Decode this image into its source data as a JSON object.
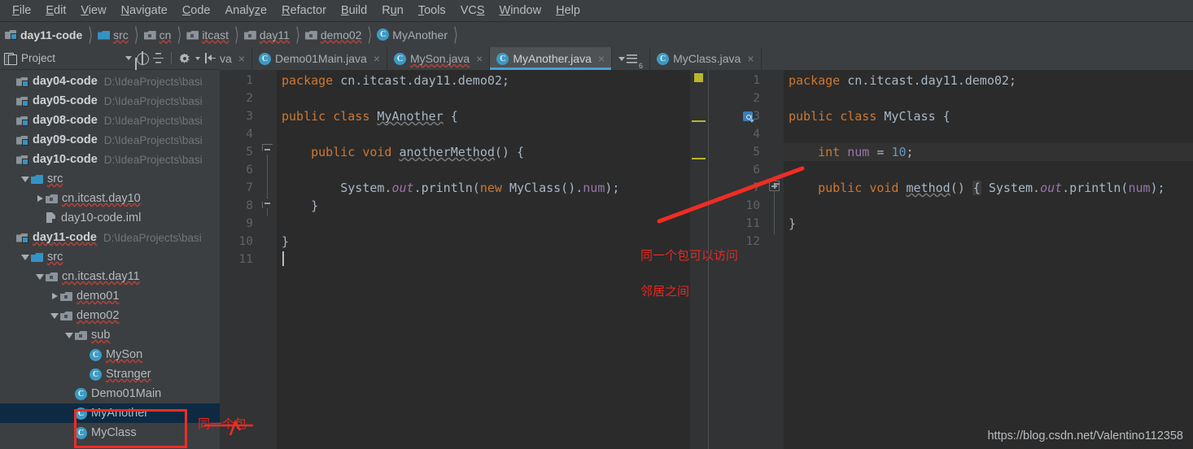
{
  "menubar": {
    "items": [
      {
        "pre": "",
        "mn": "F",
        "post": "ile"
      },
      {
        "pre": "",
        "mn": "E",
        "post": "dit"
      },
      {
        "pre": "",
        "mn": "V",
        "post": "iew"
      },
      {
        "pre": "",
        "mn": "N",
        "post": "avigate"
      },
      {
        "pre": "",
        "mn": "C",
        "post": "ode"
      },
      {
        "pre": "Analy",
        "mn": "z",
        "post": "e"
      },
      {
        "pre": "",
        "mn": "R",
        "post": "efactor"
      },
      {
        "pre": "",
        "mn": "B",
        "post": "uild"
      },
      {
        "pre": "R",
        "mn": "u",
        "post": "n"
      },
      {
        "pre": "",
        "mn": "T",
        "post": "ools"
      },
      {
        "pre": "VC",
        "mn": "S",
        "post": ""
      },
      {
        "pre": "",
        "mn": "W",
        "post": "indow"
      },
      {
        "pre": "",
        "mn": "H",
        "post": "elp"
      }
    ]
  },
  "breadcrumb": {
    "items": [
      {
        "label": "day11-code",
        "icon": "module-icon",
        "bold": true,
        "wavy": false
      },
      {
        "label": "src",
        "icon": "folder-blue-icon",
        "bold": false,
        "wavy": true
      },
      {
        "label": "cn",
        "icon": "folder-package-icon",
        "bold": false,
        "wavy": true
      },
      {
        "label": "itcast",
        "icon": "folder-package-icon",
        "bold": false,
        "wavy": true
      },
      {
        "label": "day11",
        "icon": "folder-package-icon",
        "bold": false,
        "wavy": true
      },
      {
        "label": "demo02",
        "icon": "folder-package-icon",
        "bold": false,
        "wavy": true
      },
      {
        "label": "MyAnother",
        "icon": "class-icon",
        "bold": false,
        "wavy": false
      }
    ]
  },
  "project_toolbar": {
    "title": "Project",
    "icons": [
      "project-icon",
      "chevron-down-icon",
      "locate-target-icon",
      "collapse-all-icon",
      "settings-gear-icon",
      "hide-panel-icon"
    ]
  },
  "tabs": {
    "clipped_left": "va",
    "items": [
      {
        "label": "Demo01Main.java",
        "active": false,
        "wavy": false
      },
      {
        "label": "MySon.java",
        "active": false,
        "wavy": true
      },
      {
        "label": "MyAnother.java",
        "active": true,
        "wavy": false
      },
      {
        "label": "MyClass.java",
        "active": false,
        "wavy": false
      }
    ],
    "overflow_count": "6"
  },
  "tree": {
    "items": [
      {
        "label": "day04-code",
        "path": "D:\\IdeaProjects\\basi",
        "icon": "module-icon",
        "indent": 0,
        "arrow": "none",
        "bold": true,
        "selected": false,
        "wavy": false
      },
      {
        "label": "day05-code",
        "path": "D:\\IdeaProjects\\basi",
        "icon": "module-icon",
        "indent": 0,
        "arrow": "none",
        "bold": true,
        "selected": false,
        "wavy": false
      },
      {
        "label": "day08-code",
        "path": "D:\\IdeaProjects\\basi",
        "icon": "module-icon",
        "indent": 0,
        "arrow": "none",
        "bold": true,
        "selected": false,
        "wavy": false
      },
      {
        "label": "day09-code",
        "path": "D:\\IdeaProjects\\basi",
        "icon": "module-icon",
        "indent": 0,
        "arrow": "none",
        "bold": true,
        "selected": false,
        "wavy": false
      },
      {
        "label": "day10-code",
        "path": "D:\\IdeaProjects\\basi",
        "icon": "module-icon",
        "indent": 0,
        "arrow": "none",
        "bold": true,
        "selected": false,
        "wavy": false
      },
      {
        "label": "src",
        "path": "",
        "icon": "folder-blue-icon",
        "indent": 1,
        "arrow": "down",
        "bold": false,
        "selected": false,
        "wavy": true
      },
      {
        "label": "cn.itcast.day10",
        "path": "",
        "icon": "folder-package-icon",
        "indent": 2,
        "arrow": "right",
        "bold": false,
        "selected": false,
        "wavy": true
      },
      {
        "label": "day10-code.iml",
        "path": "",
        "icon": "iml-icon",
        "indent": 2,
        "arrow": "none",
        "bold": false,
        "selected": false,
        "wavy": false
      },
      {
        "label": "day11-code",
        "path": "D:\\IdeaProjects\\basi",
        "icon": "module-icon",
        "indent": 0,
        "arrow": "none",
        "bold": true,
        "selected": false,
        "wavy": true
      },
      {
        "label": "src",
        "path": "",
        "icon": "folder-blue-icon",
        "indent": 1,
        "arrow": "down",
        "bold": false,
        "selected": false,
        "wavy": true
      },
      {
        "label": "cn.itcast.day11",
        "path": "",
        "icon": "folder-package-icon",
        "indent": 2,
        "arrow": "down",
        "bold": false,
        "selected": false,
        "wavy": true
      },
      {
        "label": "demo01",
        "path": "",
        "icon": "folder-package-icon",
        "indent": 3,
        "arrow": "right",
        "bold": false,
        "selected": false,
        "wavy": true
      },
      {
        "label": "demo02",
        "path": "",
        "icon": "folder-package-icon",
        "indent": 3,
        "arrow": "down",
        "bold": false,
        "selected": false,
        "wavy": true
      },
      {
        "label": "sub",
        "path": "",
        "icon": "folder-package-icon",
        "indent": 4,
        "arrow": "down",
        "bold": false,
        "selected": false,
        "wavy": true
      },
      {
        "label": "MySon",
        "path": "",
        "icon": "class-icon",
        "indent": 5,
        "arrow": "none",
        "bold": false,
        "selected": false,
        "wavy": true
      },
      {
        "label": "Stranger",
        "path": "",
        "icon": "class-icon",
        "indent": 5,
        "arrow": "none",
        "bold": false,
        "selected": false,
        "wavy": true
      },
      {
        "label": "Demo01Main",
        "path": "",
        "icon": "class-icon",
        "indent": 4,
        "arrow": "none",
        "bold": false,
        "selected": false,
        "wavy": false
      },
      {
        "label": "MyAnother",
        "path": "",
        "icon": "class-icon",
        "indent": 4,
        "arrow": "none",
        "bold": false,
        "selected": true,
        "wavy": false
      },
      {
        "label": "MyClass",
        "path": "",
        "icon": "class-icon",
        "indent": 4,
        "arrow": "none",
        "bold": false,
        "selected": false,
        "wavy": false
      }
    ]
  },
  "editor_left": {
    "file": "MyAnother.java",
    "line_numbers": [
      "1",
      "2",
      "3",
      "4",
      "5",
      "6",
      "7",
      "8",
      "9",
      "10",
      "11"
    ],
    "lines": [
      "package cn.itcast.day11.demo02;",
      "",
      "public class MyAnother {",
      "",
      "    public void anotherMethod() {",
      "",
      "        System.out.println(new MyClass().num);",
      "    }",
      "",
      "}",
      ""
    ],
    "caret_line": 11
  },
  "editor_right": {
    "file": "MyClass.java",
    "line_numbers": [
      "1",
      "2",
      "3",
      "4",
      "5",
      "6",
      "7",
      "10",
      "11",
      "12"
    ],
    "lines": [
      "package cn.itcast.day11.demo02;",
      "",
      "public class MyClass {",
      "",
      "    int num = 10;",
      "",
      "    public void method() { System.out.println(num);",
      "",
      "}",
      ""
    ],
    "highlight_line": 5
  },
  "annotations": {
    "same_package": "同一个包可以访问",
    "neighbors": "邻居之间",
    "same_package_tree": "同一个包"
  },
  "watermark": "https://blog.csdn.net/Valentino112358",
  "colors": {
    "accent": "#4a9fd4",
    "annotation_red": "#ef2d24",
    "keyword_orange": "#cc7832",
    "number_blue": "#6897bb",
    "field_purple": "#9876aa",
    "selection_blue": "#0d2a42",
    "warning_yellow": "#bbb529"
  }
}
